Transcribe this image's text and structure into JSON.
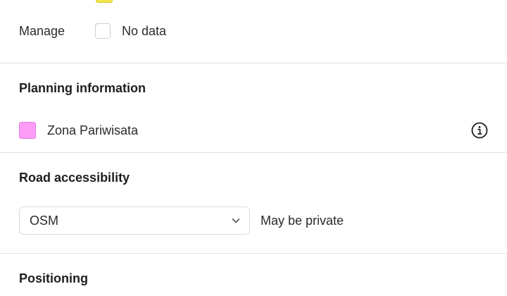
{
  "manage": {
    "label": "Manage",
    "checkbox_label": "No data"
  },
  "planning": {
    "title": "Planning information",
    "zone_label": "Zona Pariwisata",
    "zone_color": "#ff9cf7"
  },
  "road": {
    "title": "Road accessibility",
    "select_value": "OSM",
    "status": "May be private"
  },
  "positioning": {
    "title": "Positioning"
  },
  "icons": {
    "info": "info-circle-icon",
    "chevron": "chevron-down-icon"
  }
}
